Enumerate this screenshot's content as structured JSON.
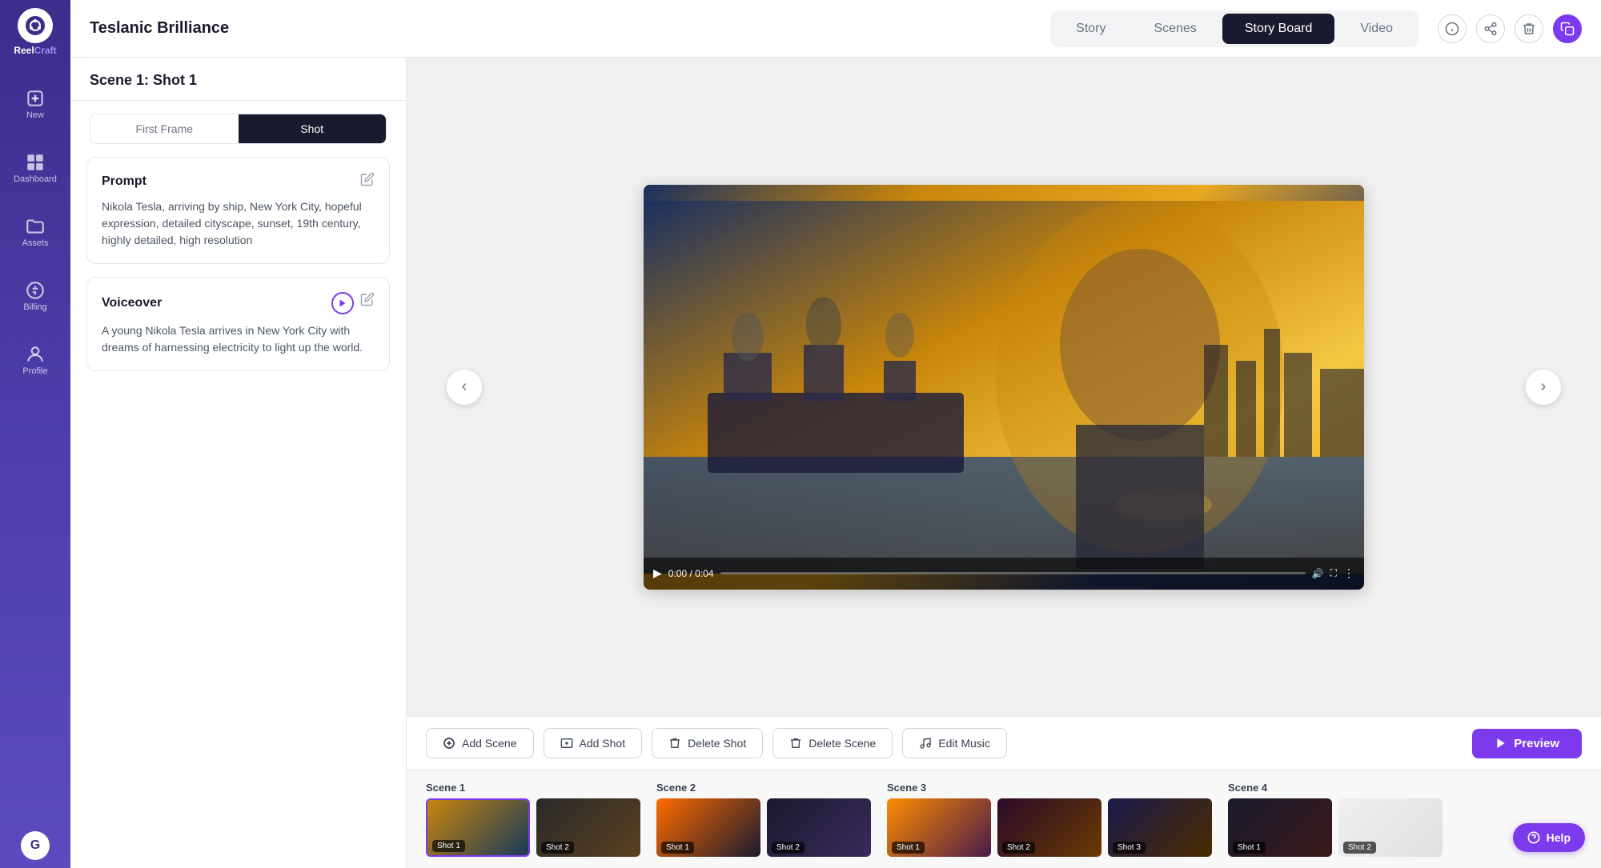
{
  "app": {
    "name": "ReelCraft",
    "logo_letter": "G"
  },
  "header": {
    "title": "Teslanic Brilliance",
    "tabs": [
      {
        "label": "Story",
        "active": false
      },
      {
        "label": "Scenes",
        "active": false
      },
      {
        "label": "Story Board",
        "active": true
      },
      {
        "label": "Video",
        "active": false
      }
    ],
    "icons": {
      "info": "ℹ",
      "share": "⬡",
      "trash": "🗑",
      "copy": "⧉"
    }
  },
  "sidebar": {
    "items": [
      {
        "label": "New",
        "icon": "plus",
        "active": false
      },
      {
        "label": "Dashboard",
        "icon": "grid",
        "active": false
      },
      {
        "label": "Assets",
        "icon": "folder",
        "active": false
      },
      {
        "label": "Billing",
        "icon": "billing",
        "active": false
      },
      {
        "label": "Profile",
        "icon": "profile",
        "active": false
      }
    ]
  },
  "left_panel": {
    "scene_title": "Scene 1: Shot 1",
    "frame_toggle": {
      "first_frame": "First Frame",
      "shot": "Shot",
      "active": "shot"
    },
    "prompt": {
      "title": "Prompt",
      "text": "Nikola Tesla, arriving by ship, New York City, hopeful expression, detailed cityscape, sunset, 19th century, highly detailed, high resolution"
    },
    "voiceover": {
      "title": "Voiceover",
      "text": "A young Nikola Tesla arrives in New York City with dreams of harnessing electricity to light up the world."
    }
  },
  "video": {
    "time_current": "0:00",
    "time_total": "0:04",
    "time_display": "0:00 / 0:04"
  },
  "toolbar": {
    "add_scene": "Add Scene",
    "add_shot": "Add Shot",
    "delete_shot": "Delete Shot",
    "delete_scene": "Delete Scene",
    "edit_music": "Edit Music",
    "preview": "Preview"
  },
  "filmstrip": {
    "scenes": [
      {
        "label": "Scene 1",
        "shots": [
          {
            "label": "Shot 1",
            "active": true,
            "color": "thumb-1a"
          },
          {
            "label": "Shot 2",
            "active": false,
            "color": "thumb-1b"
          }
        ]
      },
      {
        "label": "Scene 2",
        "shots": [
          {
            "label": "Shot 1",
            "active": false,
            "color": "thumb-2a"
          },
          {
            "label": "Shot 2",
            "active": false,
            "color": "thumb-2b"
          }
        ]
      },
      {
        "label": "Scene 3",
        "shots": [
          {
            "label": "Shot 1",
            "active": false,
            "color": "thumb-3a"
          },
          {
            "label": "Shot 2",
            "active": false,
            "color": "thumb-3b"
          },
          {
            "label": "Shot 3",
            "active": false,
            "color": "thumb-3c"
          }
        ]
      },
      {
        "label": "Scene 4",
        "shots": [
          {
            "label": "Shot 1",
            "active": false,
            "color": "thumb-4a"
          },
          {
            "label": "Shot 2",
            "active": false,
            "color": "thumb-4b"
          }
        ]
      }
    ]
  },
  "help": {
    "label": "Help"
  }
}
